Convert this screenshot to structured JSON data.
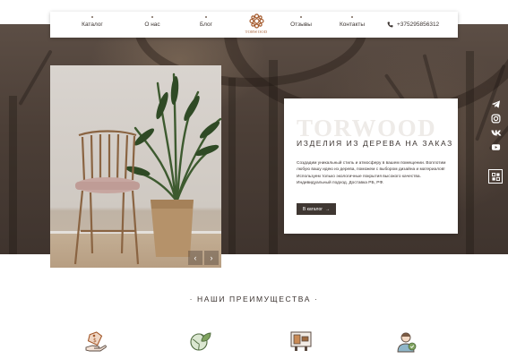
{
  "nav": {
    "items": [
      {
        "label": "Каталог"
      },
      {
        "label": "О нас"
      },
      {
        "label": "Блог"
      },
      {
        "label": "Отзывы"
      },
      {
        "label": "Контакты"
      }
    ],
    "logo_text": "TORWOOD",
    "phone": "+375295856312"
  },
  "hero": {
    "brand": "TORWOOD",
    "subtitle": "ИЗДЕЛИЯ ИЗ ДЕРЕВА НА ЗАКАЗ",
    "description": "Создадим уникальный стиль и атмосферу в вашем помещении. Воплотим любую вашу идею из дерева, поможем с выбором дизайна и материалов! Используем только экологичные покрытия высокого качества. Индивидуальный подход. Доставка РБ, РФ.",
    "cta_label": "В каталог",
    "cta_arrow": "→",
    "prev_arrow": "‹",
    "next_arrow": "›"
  },
  "social": {
    "icons": [
      "telegram-icon",
      "instagram-icon",
      "vk-icon",
      "youtube-icon"
    ],
    "menu_icon": "grid-menu-icon"
  },
  "advantages": {
    "title": "· НАШИ ПРЕИМУЩЕСТВА ·",
    "icons": [
      "price-tag-hand-icon",
      "eco-globe-leaf-icon",
      "workshop-furniture-icon",
      "support-person-icon"
    ]
  },
  "colors": {
    "accent": "#a3582a",
    "dark": "#3f3732",
    "text": "#3b3330"
  }
}
